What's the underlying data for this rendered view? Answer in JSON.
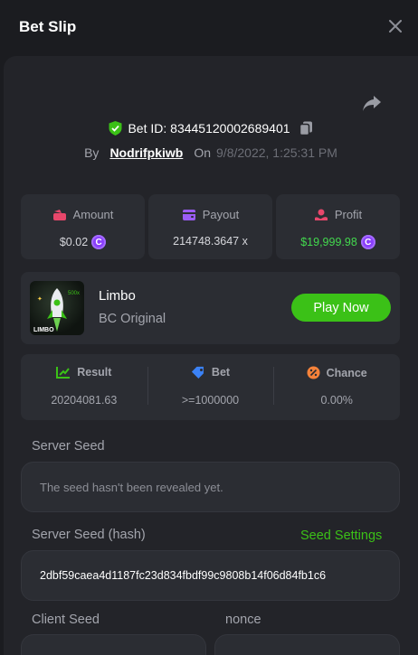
{
  "header": {
    "title": "Bet Slip"
  },
  "bet": {
    "id_label": "Bet ID: 83445120002689401",
    "by_label": "By",
    "user": "Nodrifpkiwb",
    "on_label": "On",
    "date": "9/8/2022, 1:25:31 PM"
  },
  "stats": {
    "amount": {
      "label": "Amount",
      "value": "$0.02"
    },
    "payout": {
      "label": "Payout",
      "value": "214748.3647 x"
    },
    "profit": {
      "label": "Profit",
      "value": "$19,999.98"
    }
  },
  "game": {
    "name": "Limbo",
    "subtitle": "BC Original",
    "thumb_text": "LIMBO",
    "thumb_badge": "500x",
    "play_label": "Play Now"
  },
  "result": {
    "result": {
      "label": "Result",
      "value": "20204081.63"
    },
    "bet": {
      "label": "Bet",
      "value": ">=1000000"
    },
    "chance": {
      "label": "Chance",
      "value": "0.00%"
    }
  },
  "seeds": {
    "server_seed_label": "Server Seed",
    "server_seed_value": "The seed hasn't been revealed yet.",
    "server_hash_label": "Server Seed (hash)",
    "seed_settings_label": "Seed Settings",
    "server_hash_value": "2dbf59caea4d1187fc23d834fbdf99c9808b14f06d84fb1c6",
    "client_seed_label": "Client Seed",
    "nonce_label": "nonce"
  },
  "colors": {
    "accent_green": "#3bc117",
    "profit_green": "#43d94e",
    "coin_purple": "#8a3ffc",
    "panel": "#232429",
    "card": "#2b2d33"
  },
  "icons": [
    "close-icon",
    "share-icon",
    "shield-check-icon",
    "copy-icon",
    "amount-icon",
    "wallet-icon",
    "profit-icon",
    "coin-icon",
    "result-chart-icon",
    "bet-tag-icon",
    "chance-percent-icon"
  ]
}
